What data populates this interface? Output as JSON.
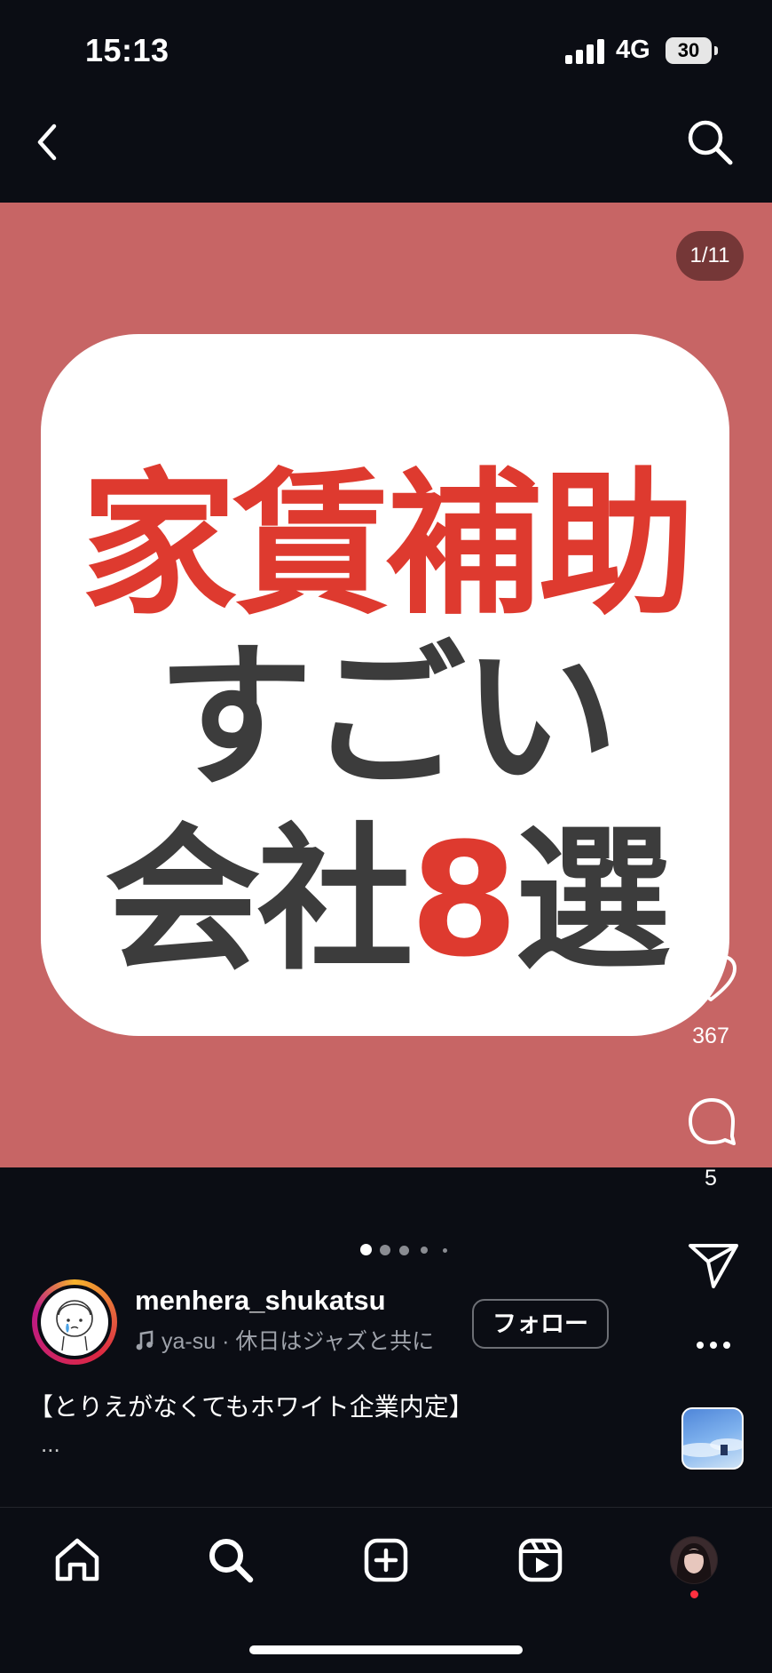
{
  "status_bar": {
    "time": "15:13",
    "network": "4G",
    "battery": "30"
  },
  "header": {
    "back_icon": "chevron-left-icon",
    "search_icon": "search-icon"
  },
  "post": {
    "counter": "1/11",
    "headline_line1": "家賃補助",
    "headline_line2": "すごい",
    "headline_line3_a": "会社",
    "headline_line3_num": "8",
    "headline_line3_b": "選",
    "background_color": "#c76565",
    "accent_red": "#de3a2f"
  },
  "actions": {
    "likes": "367",
    "comments": "5"
  },
  "profile": {
    "username": "menhera_shukatsu",
    "music": "ya-su · 休日はジャズと共に",
    "follow_label": "フォロー",
    "caption": "【とりえがなくてもホワイト企業内定】",
    "more": "..."
  },
  "nav": {
    "items": [
      "home-icon",
      "search-icon",
      "create-icon",
      "reels-icon",
      "profile-avatar"
    ]
  }
}
